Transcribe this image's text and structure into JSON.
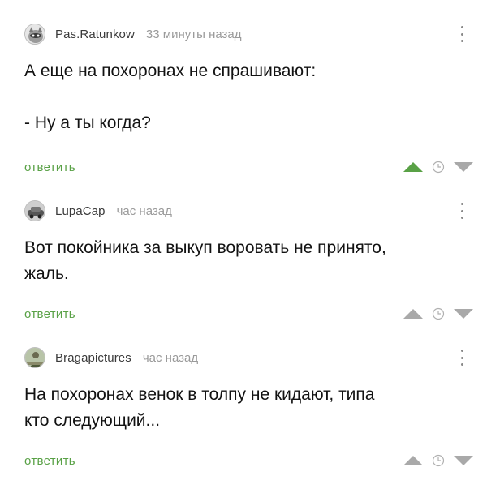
{
  "comments": [
    {
      "username": "Pas.Ratunkow",
      "time": "33 минуты назад",
      "lines": [
        "А еще на похоронах не спрашивают:",
        "",
        "- Ну а ты когда?"
      ],
      "reply_label": "ответить",
      "upvote_active": true
    },
    {
      "username": "LupaCap",
      "time": "час назад",
      "lines": [
        "Вот покойника за выкуп воровать не принято,",
        "жаль."
      ],
      "reply_label": "ответить",
      "upvote_active": false
    },
    {
      "username": "Bragapictures",
      "time": "час назад",
      "lines": [
        "На похоронах венок в толпу не кидают, типа",
        "кто следующий..."
      ],
      "reply_label": "ответить",
      "upvote_active": false
    }
  ],
  "icons": {
    "avatar_1": "raccoon-avatar-icon",
    "avatar_2": "car-avatar-icon",
    "avatar_3": "figure-avatar-icon",
    "more": "more-vertical-icon",
    "upvote": "upvote-triangle-icon",
    "clock": "clock-icon",
    "downvote": "downvote-triangle-icon"
  },
  "colors": {
    "reply_link": "#59a146",
    "upvote_active": "#59a146",
    "vote_inactive": "#a9a9a9"
  }
}
